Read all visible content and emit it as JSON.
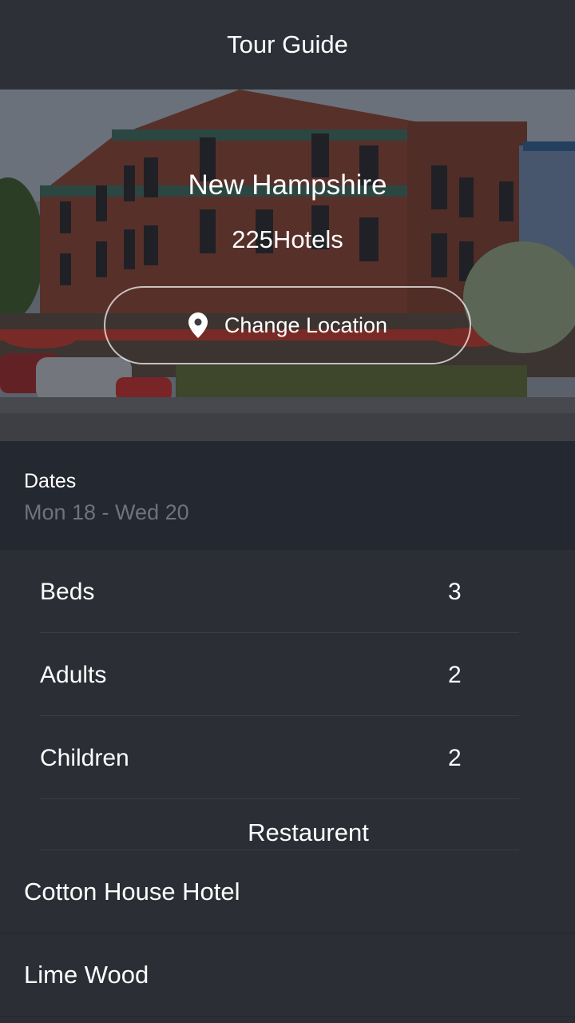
{
  "app": {
    "title": "Tour Guide"
  },
  "hero": {
    "city": "New Hampshire",
    "hotel_count": "225Hotels",
    "change_location_label": "Change Location",
    "icon": "location-pin-icon"
  },
  "dates": {
    "label": "Dates",
    "value": "Mon 18 - Wed 20"
  },
  "details": {
    "rows": [
      {
        "label": "Beds",
        "value": "3"
      },
      {
        "label": "Adults",
        "value": "2"
      },
      {
        "label": "Children",
        "value": "2"
      }
    ],
    "section_label": "Restaurent"
  },
  "hotels": [
    {
      "name": "Cotton House Hotel"
    },
    {
      "name": "Lime Wood"
    }
  ],
  "colors": {
    "appbar": "#2e3038",
    "dates_bg": "#242831",
    "list_bg": "#2b2e35",
    "muted_text": "#6f737b"
  }
}
